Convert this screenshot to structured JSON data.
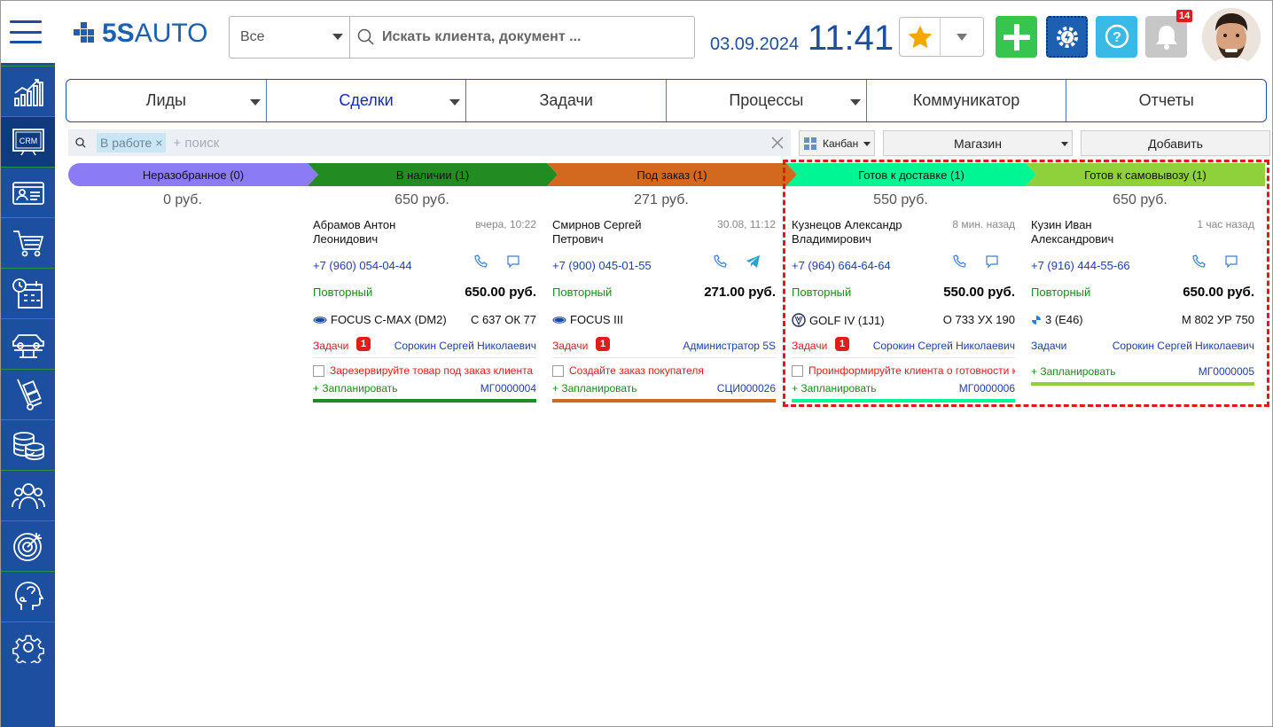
{
  "app": {
    "logo_text": "5SAUTO",
    "scope": "Все",
    "search_placeholder": "Искать клиента, документ ...",
    "date": "03.09.2024",
    "time": "11:41",
    "notification_count": "14"
  },
  "colors": {
    "brand": "#1d4fa0",
    "add": "#37c44f",
    "help": "#39b9e6",
    "alert": "#e31b1b"
  },
  "sidebar": {
    "items": [
      {
        "icon": "analytics-chart-icon"
      },
      {
        "icon": "crm-icon",
        "label": "CRM",
        "active": true
      },
      {
        "icon": "contact-card-icon"
      },
      {
        "icon": "shopping-cart-icon"
      },
      {
        "icon": "calendar-clock-icon"
      },
      {
        "icon": "car-lift-icon"
      },
      {
        "icon": "hand-truck-icon"
      },
      {
        "icon": "coins-stack-icon"
      },
      {
        "icon": "team-icon"
      },
      {
        "icon": "target-icon"
      },
      {
        "icon": "support-head-icon"
      },
      {
        "icon": "settings-gear-icon"
      }
    ]
  },
  "nav": {
    "tabs": [
      {
        "label": "Лиды",
        "dropdown": true
      },
      {
        "label": "Сделки",
        "dropdown": true,
        "selected": true
      },
      {
        "label": "Задачи"
      },
      {
        "label": "Процессы",
        "dropdown": true
      },
      {
        "label": "Коммуникатор"
      },
      {
        "label": "Отчеты"
      }
    ]
  },
  "filter": {
    "chip": "В работе",
    "chip_close": "×",
    "placeholder": "+ поиск",
    "view": "Канбан",
    "store": "Магазин",
    "add_button": "Добавить"
  },
  "stages": [
    {
      "label": "Неразобранное (0)",
      "total": "0 руб.",
      "color": "#8b7bf5"
    },
    {
      "label": "В наличии (1)",
      "total": "650 руб.",
      "color": "#228b22"
    },
    {
      "label": "Под заказ (1)",
      "total": "271 руб.",
      "color": "#d2691e"
    },
    {
      "label": "Готов к доставке (1)",
      "total": "550 руб.",
      "color": "#00f593"
    },
    {
      "label": "Готов к самовывозу (1)",
      "total": "650 руб.",
      "color": "#8fd13a"
    }
  ],
  "cards": [
    {
      "name": "Абрамов Антон Леонидович",
      "time": "вчера, 10:22",
      "phone": "+7 (960) 054-04-44",
      "type": "Повторный",
      "amount": "650.00 руб.",
      "car": "FOCUS C-MAX (DM2)",
      "brand": "ford",
      "plate": "С 637 ОК 77",
      "tasks_label": "Задачи",
      "tasks_count": "1",
      "manager": "Сорокин Сергей Николаевич",
      "task": "Зарезервируйте товар под заказ клиента и...",
      "plan": "+ Запланировать",
      "number": "МГ0000004",
      "bar_color": "#228b22",
      "second_icon": "chat"
    },
    {
      "name": "Смирнов Сергей Петрович",
      "time": "30.08, 11:12",
      "phone": "+7 (900) 045-01-55",
      "type": "Повторный",
      "amount": "271.00 руб.",
      "car": "FOCUS III",
      "brand": "ford",
      "plate": "",
      "tasks_label": "Задачи",
      "tasks_count": "1",
      "manager": "Администратор 5S",
      "task": "Создайте заказ покупателя",
      "plan": "+ Запланировать",
      "number": "СЦИ000026",
      "bar_color": "#d2691e",
      "second_icon": "telegram"
    },
    {
      "name": "Кузнецов Александр Владимирович",
      "time": "8 мин. назад",
      "phone": "+7 (964) 664-64-64",
      "type": "Повторный",
      "amount": "550.00 руб.",
      "car": "GOLF IV (1J1)",
      "brand": "vw",
      "plate": "О 733 УХ 190",
      "tasks_label": "Задачи",
      "tasks_count": "1",
      "manager": "Сорокин Сергей Николаевич",
      "task": "Проинформируйте клиента о готовности к д...",
      "plan": "+ Запланировать",
      "number": "МГ0000006",
      "bar_color": "#00f593",
      "second_icon": "chat"
    },
    {
      "name": "Кузин Иван Александрович",
      "time": "1 час назад",
      "phone": "+7 (916) 444-55-66",
      "type": "Повторный",
      "amount": "650.00 руб.",
      "car": "3 (E46)",
      "brand": "bmw",
      "plate": "М 802 УР 750",
      "tasks_label": "Задачи",
      "tasks_count": "",
      "manager": "Сорокин Сергей Николаевич",
      "task": "",
      "plan": "+ Запланировать",
      "number": "МГ0000005",
      "bar_color": "#8fd13a",
      "second_icon": "chat"
    }
  ]
}
